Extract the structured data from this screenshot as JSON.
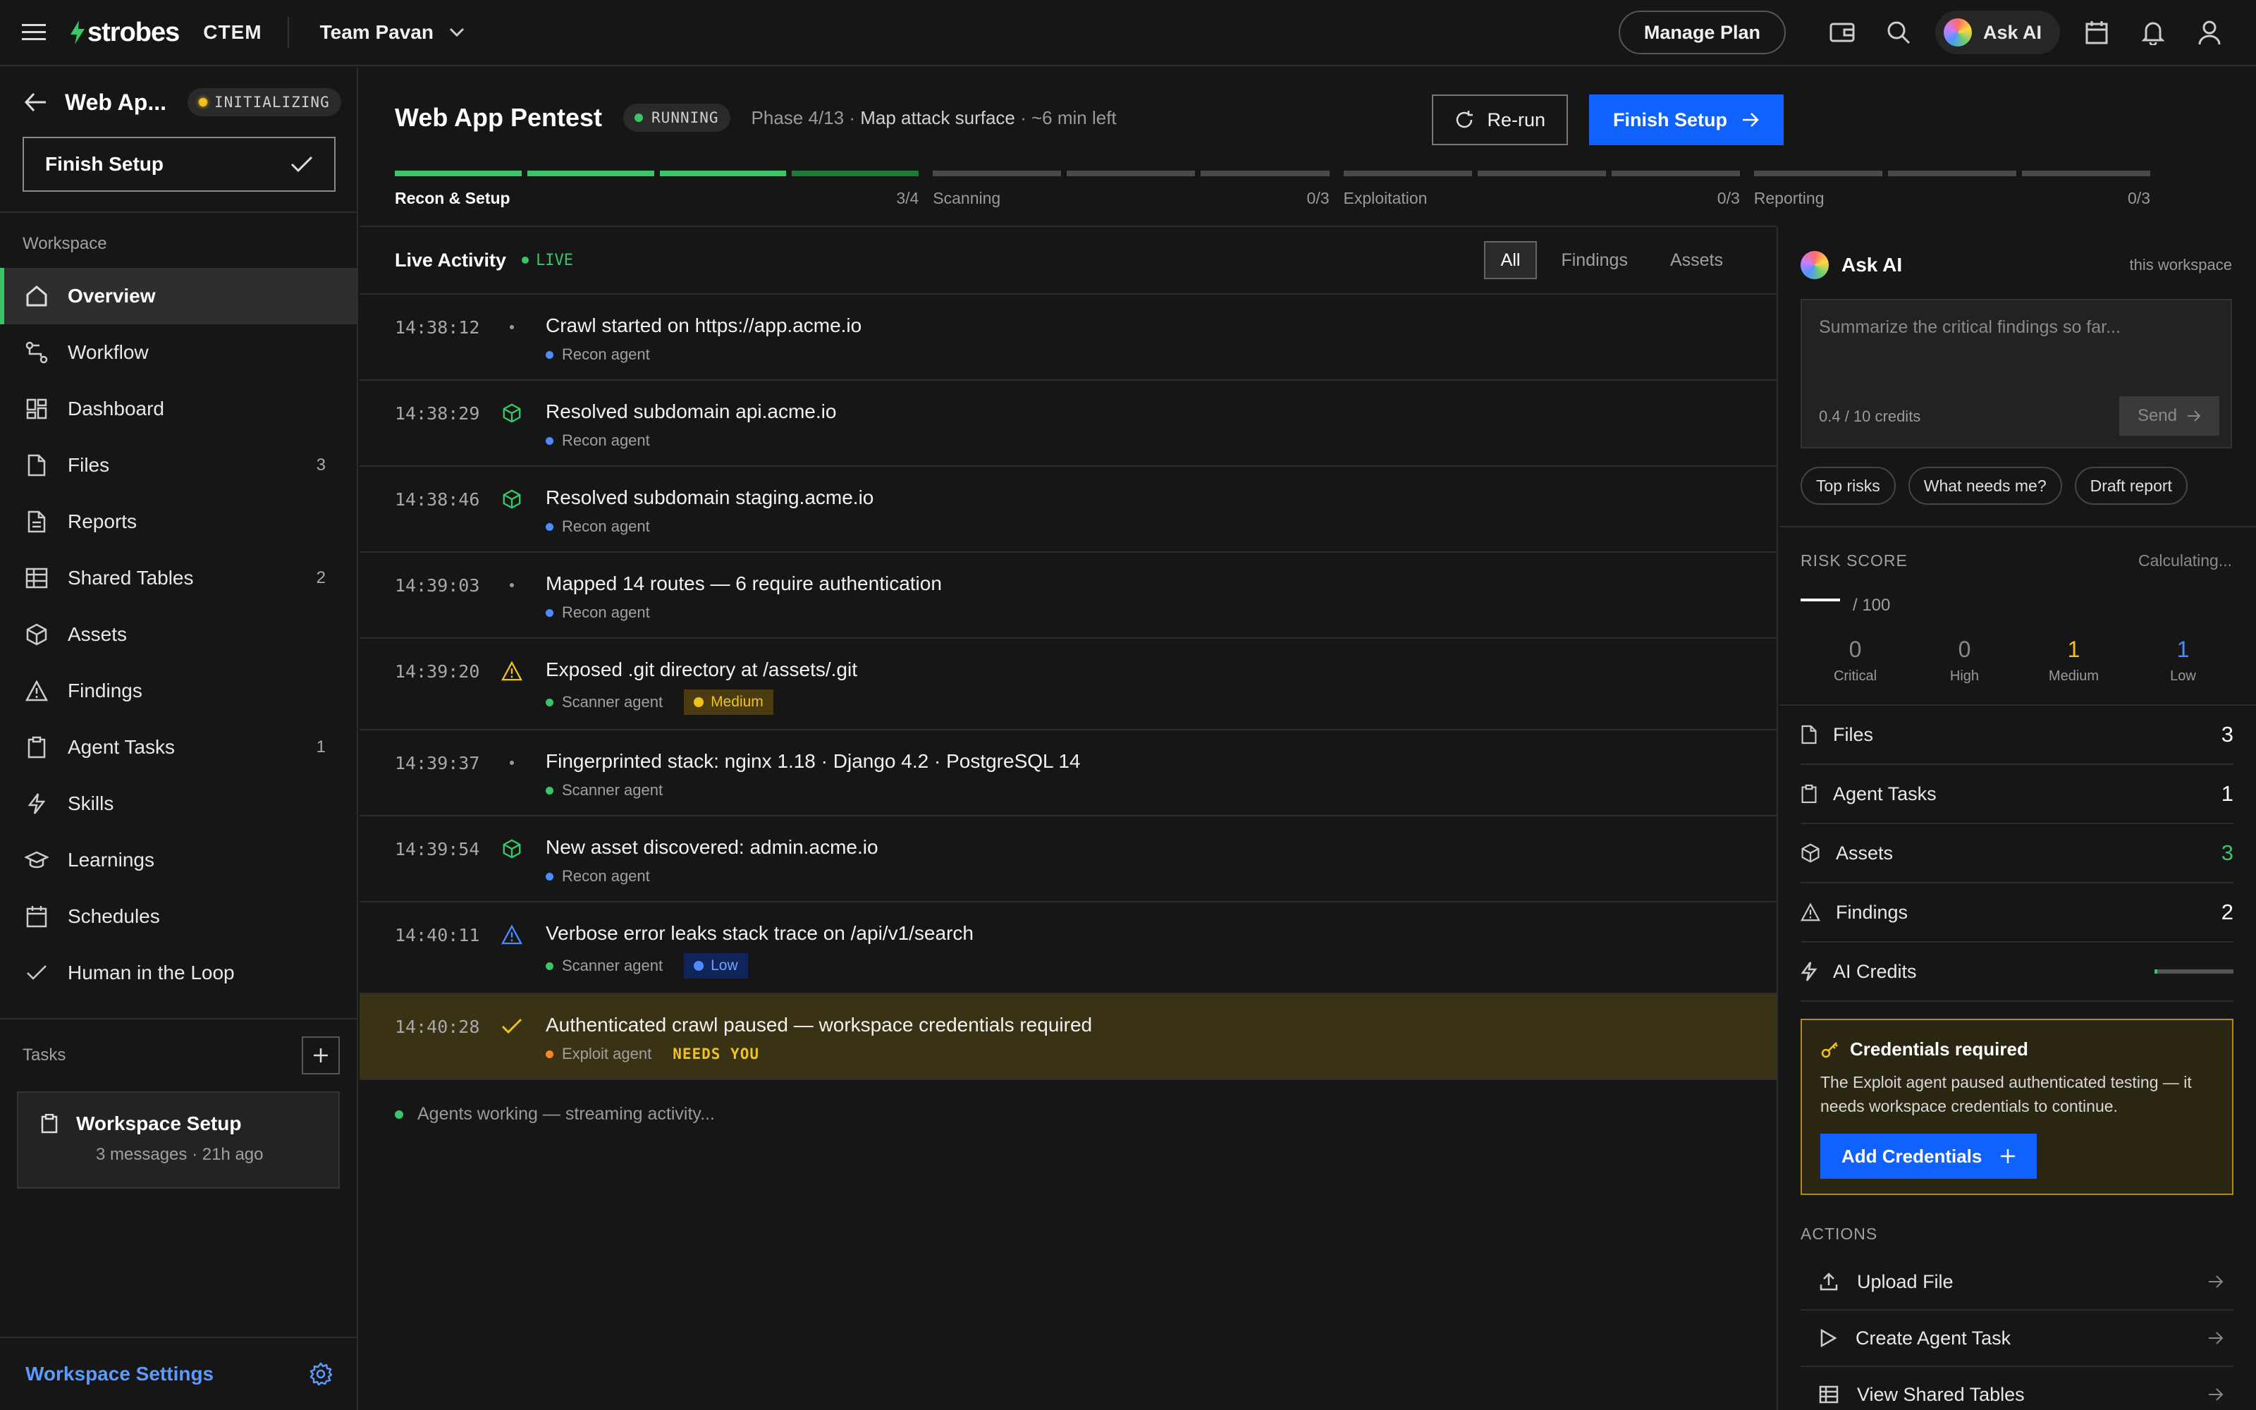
{
  "topbar": {
    "brand": "strobes",
    "product": "CTEM",
    "team": "Team Pavan",
    "manage_plan": "Manage Plan",
    "ask_ai": "Ask AI"
  },
  "sidebar": {
    "title": "Web Ap...",
    "status": "INITIALIZING",
    "status_color": "#f1c21b",
    "finish_setup": "Finish Setup",
    "section": "Workspace",
    "items": [
      {
        "label": "Overview",
        "icon": "home-icon",
        "count": ""
      },
      {
        "label": "Workflow",
        "icon": "workflow-icon",
        "count": ""
      },
      {
        "label": "Dashboard",
        "icon": "dashboard-icon",
        "count": ""
      },
      {
        "label": "Files",
        "icon": "file-icon",
        "count": "3"
      },
      {
        "label": "Reports",
        "icon": "report-icon",
        "count": ""
      },
      {
        "label": "Shared Tables",
        "icon": "table-icon",
        "count": "2"
      },
      {
        "label": "Assets",
        "icon": "cube-icon",
        "count": ""
      },
      {
        "label": "Findings",
        "icon": "warning-icon",
        "count": ""
      },
      {
        "label": "Agent Tasks",
        "icon": "clipboard-icon",
        "count": "1"
      },
      {
        "label": "Skills",
        "icon": "bolt-icon",
        "count": ""
      },
      {
        "label": "Learnings",
        "icon": "graduation-cap-icon",
        "count": ""
      },
      {
        "label": "Schedules",
        "icon": "calendar-icon",
        "count": ""
      },
      {
        "label": "Human in the Loop",
        "icon": "check-icon",
        "count": ""
      }
    ],
    "tasks_label": "Tasks",
    "task": {
      "title": "Workspace Setup",
      "meta": "3 messages · 21h ago"
    },
    "settings": "Workspace Settings"
  },
  "header": {
    "title": "Web App Pentest",
    "status": "RUNNING",
    "phase_prefix": "Phase 4/13 ·",
    "phase_name": "Map attack surface",
    "phase_suffix": "· ~6 min left",
    "rerun": "Re-run",
    "finish_setup": "Finish Setup",
    "phases": [
      {
        "name": "Recon & Setup",
        "progress": "3/4",
        "done": 3,
        "total": 4
      },
      {
        "name": "Scanning",
        "progress": "0/3",
        "done": 0,
        "total": 3
      },
      {
        "name": "Exploitation",
        "progress": "0/3",
        "done": 0,
        "total": 3
      },
      {
        "name": "Reporting",
        "progress": "0/3",
        "done": 0,
        "total": 3
      }
    ]
  },
  "activity": {
    "title": "Live Activity",
    "live": "LIVE",
    "filters": [
      "All",
      "Findings",
      "Assets"
    ],
    "rows": [
      {
        "time": "14:38:12",
        "icon": "dot-icon",
        "title": "Crawl started on https://app.acme.io",
        "agent": "Recon agent",
        "agent_color": "#4d8bff",
        "severity": "",
        "needs": ""
      },
      {
        "time": "14:38:29",
        "icon": "cube-icon",
        "title": "Resolved subdomain api.acme.io",
        "agent": "Recon agent",
        "agent_color": "#4d8bff",
        "severity": "",
        "needs": ""
      },
      {
        "time": "14:38:46",
        "icon": "cube-icon",
        "title": "Resolved subdomain staging.acme.io",
        "agent": "Recon agent",
        "agent_color": "#4d8bff",
        "severity": "",
        "needs": ""
      },
      {
        "time": "14:39:03",
        "icon": "dot-icon",
        "title": "Mapped 14 routes — 6 require authentication",
        "agent": "Recon agent",
        "agent_color": "#4d8bff",
        "severity": "",
        "needs": ""
      },
      {
        "time": "14:39:20",
        "icon": "warning-icon",
        "title": "Exposed .git directory at /assets/.git",
        "agent": "Scanner agent",
        "agent_color": "#3ac569",
        "severity": "Medium",
        "needs": ""
      },
      {
        "time": "14:39:37",
        "icon": "dot-icon",
        "title": "Fingerprinted stack: nginx 1.18 · Django 4.2 · PostgreSQL 14",
        "agent": "Scanner agent",
        "agent_color": "#3ac569",
        "severity": "",
        "needs": ""
      },
      {
        "time": "14:39:54",
        "icon": "cube-icon",
        "title": "New asset discovered: admin.acme.io",
        "agent": "Recon agent",
        "agent_color": "#4d8bff",
        "severity": "",
        "needs": ""
      },
      {
        "time": "14:40:11",
        "icon": "warning-icon",
        "title": "Verbose error leaks stack trace on /api/v1/search",
        "agent": "Scanner agent",
        "agent_color": "#3ac569",
        "severity": "Low",
        "needs": ""
      },
      {
        "time": "14:40:28",
        "icon": "check-icon",
        "title": "Authenticated crawl paused — workspace credentials required",
        "agent": "Exploit agent",
        "agent_color": "#ff832b",
        "severity": "",
        "needs": "NEEDS YOU"
      }
    ],
    "streaming": "Agents working — streaming activity..."
  },
  "ask": {
    "title": "Ask AI",
    "scope": "this workspace",
    "placeholder": "Summarize the critical findings so far...",
    "credits": "0.4 / 10 credits",
    "send": "Send",
    "chips": [
      "Top risks",
      "What needs me?",
      "Draft report"
    ]
  },
  "risk": {
    "label": "RISK SCORE",
    "status": "Calculating...",
    "of": "/ 100",
    "severities": [
      {
        "label": "Critical",
        "count": "0",
        "color": "#8a8a8a"
      },
      {
        "label": "High",
        "count": "0",
        "color": "#8a8a8a"
      },
      {
        "label": "Medium",
        "count": "1",
        "color": "#f1c21b"
      },
      {
        "label": "Low",
        "count": "1",
        "color": "#4d8bff"
      }
    ]
  },
  "stats": [
    {
      "label": "Files",
      "value": "3",
      "icon": "file-icon",
      "color": "#ffffff"
    },
    {
      "label": "Agent Tasks",
      "value": "1",
      "icon": "clipboard-icon",
      "color": "#ffffff"
    },
    {
      "label": "Assets",
      "value": "3",
      "icon": "cube-icon",
      "color": "#3ac569"
    },
    {
      "label": "Findings",
      "value": "2",
      "icon": "warning-icon",
      "color": "#ffffff"
    }
  ],
  "ai_credits": {
    "label": "AI Credits",
    "used_fraction": 0.04
  },
  "credentials": {
    "title": "Credentials required",
    "desc": "The Exploit agent paused authenticated testing — it needs workspace credentials to continue.",
    "button": "Add Credentials"
  },
  "actions": {
    "title": "ACTIONS",
    "items": [
      {
        "label": "Upload File",
        "icon": "upload-icon"
      },
      {
        "label": "Create Agent Task",
        "icon": "play-icon"
      },
      {
        "label": "View Shared Tables",
        "icon": "table-icon"
      }
    ]
  }
}
